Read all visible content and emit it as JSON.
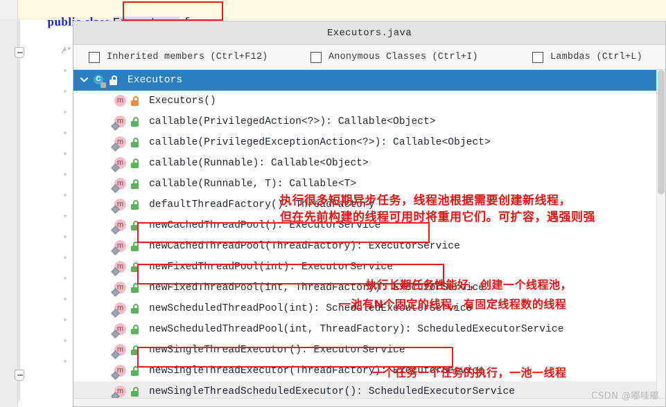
{
  "editor": {
    "code_line": {
      "kw1": "public",
      "kw2": "class",
      "class_name": "Executors",
      "brace": "{"
    },
    "javadoc_fragment": "/*"
  },
  "popup": {
    "title": "Executors.java",
    "checkboxes": [
      {
        "label": "Inherited members (Ctrl+F12)",
        "checked": false
      },
      {
        "label": "Anonymous Classes (Ctrl+I)",
        "checked": false
      },
      {
        "label": "Lambdas (Ctrl+L)",
        "checked": false
      }
    ],
    "rows": [
      {
        "text": "Executors",
        "kind": "class",
        "lock": "white",
        "selected": true,
        "expanded": true
      },
      {
        "text": "Executors()",
        "kind": "method",
        "lock": "orange",
        "static": false
      },
      {
        "text": "callable(PrivilegedAction<?>): Callable<Object>",
        "kind": "method",
        "lock": "green",
        "static": true
      },
      {
        "text": "callable(PrivilegedExceptionAction<?>): Callable<Object>",
        "kind": "method",
        "lock": "green",
        "static": true
      },
      {
        "text": "callable(Runnable): Callable<Object>",
        "kind": "method",
        "lock": "green",
        "static": true
      },
      {
        "text": "callable(Runnable, T): Callable<T>",
        "kind": "method",
        "lock": "green",
        "static": true
      },
      {
        "text": "defaultThreadFactory(): ThreadFactory",
        "kind": "method",
        "lock": "green",
        "static": true
      },
      {
        "text": "newCachedThreadPool(): ExecutorService",
        "kind": "method",
        "lock": "green",
        "static": true
      },
      {
        "text": "newCachedThreadPool(ThreadFactory): ExecutorService",
        "kind": "method",
        "lock": "green",
        "static": true
      },
      {
        "text": "newFixedThreadPool(int): ExecutorService",
        "kind": "method",
        "lock": "green",
        "static": true
      },
      {
        "text": "newFixedThreadPool(int, ThreadFactory): ExecutorService",
        "kind": "method",
        "lock": "green",
        "static": true
      },
      {
        "text": "newScheduledThreadPool(int): ScheduledExecutorService",
        "kind": "method",
        "lock": "green",
        "static": true
      },
      {
        "text": "newScheduledThreadPool(int, ThreadFactory): ScheduledExecutorService",
        "kind": "method",
        "lock": "green",
        "static": true
      },
      {
        "text": "newSingleThreadExecutor(): ExecutorService",
        "kind": "method",
        "lock": "green",
        "static": true
      },
      {
        "text": "newSingleThreadExecutor(ThreadFactory): ExecutorService",
        "kind": "method",
        "lock": "green",
        "static": true
      },
      {
        "text": "newSingleThreadScheduledExecutor(): ScheduledExecutorService",
        "kind": "method",
        "lock": "green",
        "static": true,
        "alt": true
      }
    ]
  },
  "annotations": {
    "color": "#e81111",
    "notes": [
      {
        "line1": "执行很多短期异步任务，线程池根据需要创建新线程，",
        "line2": "但在先前构建的线程可用时将重用它们。可扩容，遇强则强"
      },
      {
        "line1": "执行长期任务性能好，创建一个线程池，",
        "line2": "一池有N个固定的线程，有固定线程数的线程"
      },
      {
        "line1": "一个任务一个任务的执行，一池一线程",
        "line2": ""
      }
    ]
  },
  "watermark": "CSDN @嘟哇嘟"
}
